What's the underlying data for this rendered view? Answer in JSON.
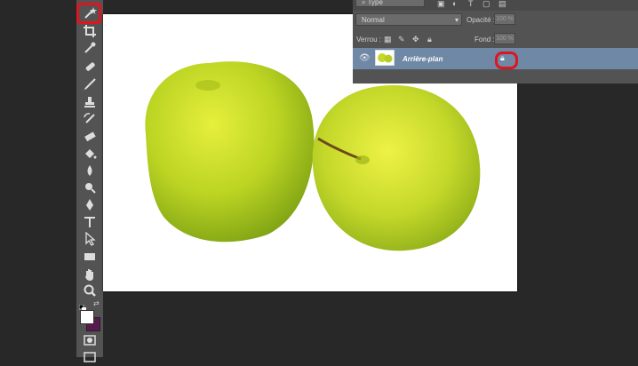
{
  "layers_panel": {
    "filter_kind": "Type",
    "blend_mode": "Normal",
    "opacity_label": "Opacité :",
    "opacity_value": "100 %",
    "lock_label": "Verrou :",
    "fill_label": "Fond :",
    "fill_value": "100 %",
    "layer_name": "Arrière-plan"
  },
  "colors": {
    "foreground": "#ffffff",
    "background": "#5a1a4f",
    "highlight": "#e0141e",
    "selected_layer": "#6e88a6"
  },
  "tools": [
    "magic-wand",
    "crop",
    "eyedropper",
    "spot-healing",
    "brush",
    "clone-stamp",
    "history-brush",
    "eraser",
    "paint-bucket",
    "blur",
    "dodge",
    "pen",
    "type",
    "path-selection",
    "rectangle",
    "hand",
    "zoom"
  ]
}
